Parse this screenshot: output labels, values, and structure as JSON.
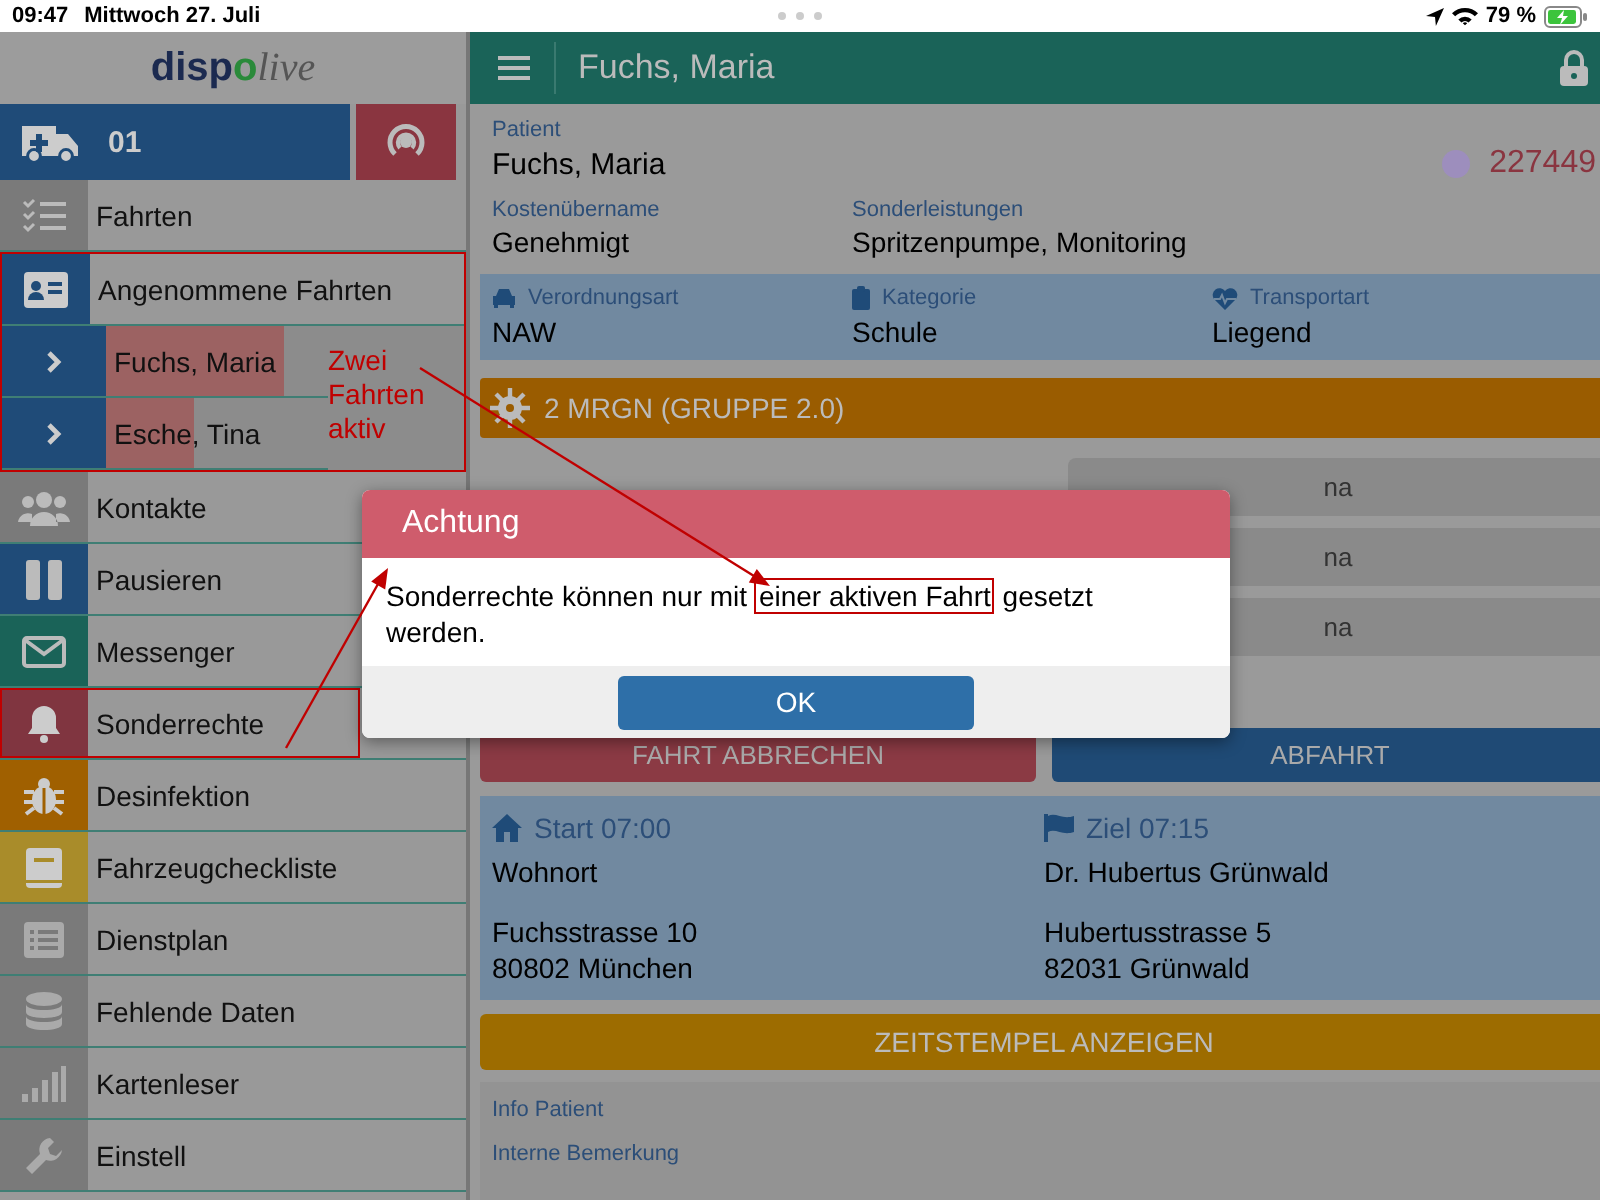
{
  "status_bar": {
    "time": "09:47",
    "date": "Mittwoch 27. Juli",
    "battery": "79 %"
  },
  "sidebar": {
    "logo": {
      "first": "disp",
      "mark": "o",
      "last": "live"
    },
    "unit": {
      "label": "01"
    },
    "items": [
      {
        "label": "Fahrten",
        "color": "#7a7a7a"
      },
      {
        "label": "Angenommene Fahrten",
        "color": "#1f4b78",
        "children": [
          {
            "label": "Fuchs, Maria",
            "level": 0.8
          },
          {
            "label": "Esche, Tina",
            "level": 0.4
          }
        ]
      },
      {
        "label": "Kontakte",
        "color": "#7a7a7a"
      },
      {
        "label": "Pausieren",
        "color": "#1f4b78"
      },
      {
        "label": "Messenger",
        "color": "#1a6358"
      },
      {
        "label": "Sonderrechte",
        "color": "#803540"
      },
      {
        "label": "Desinfektion",
        "color": "#a06000"
      },
      {
        "label": "Fahrzeugcheckliste",
        "color": "#a98c2a"
      },
      {
        "label": "Dienstplan",
        "color": "#7a7a7a"
      },
      {
        "label": "Fehlende Daten",
        "color": "#7a7a7a"
      },
      {
        "label": "Kartenleser",
        "color": "#7a7a7a"
      },
      {
        "label": "Einstell",
        "color": "#7a7a7a"
      }
    ]
  },
  "header": {
    "title": "Fuchs, Maria"
  },
  "patient": {
    "label": "Patient",
    "name": "Fuchs, Maria",
    "number": "227449"
  },
  "fields": [
    {
      "label": "Kostenübername",
      "value": "Genehmigt"
    },
    {
      "label": "Sonderleistungen",
      "value": "Spritzenpumpe, Monitoring"
    }
  ],
  "transport": [
    {
      "label": "Verordnungsart",
      "value": "NAW"
    },
    {
      "label": "Kategorie",
      "value": "Schule"
    },
    {
      "label": "Transportart",
      "value": "Liegend"
    }
  ],
  "infection": "2 MRGN (GRUPPE 2.0)",
  "status_buttons": [
    "na",
    "na",
    "na"
  ],
  "actions": [
    {
      "label": "FAHRT ABBRECHEN",
      "kind": "cancel"
    },
    {
      "label": "ABFAHRT",
      "kind": "go"
    }
  ],
  "route": [
    {
      "heading": "Start 07:00",
      "place": "Wohnort",
      "street": "Fuchsstrasse 10",
      "city": "80802 München"
    },
    {
      "heading": "Ziel 07:15",
      "place": "Dr. Hubertus Grünwald",
      "street": "Hubertusstrasse 5",
      "city": "82031 Grünwald"
    }
  ],
  "timestamps_button": "ZEITSTEMPEL ANZEIGEN",
  "info": [
    "Info Patient",
    "Interne Bemerkung"
  ],
  "dialog": {
    "title": "Achtung",
    "message": {
      "before": "Sonderrechte können nur mit ",
      "highlight": "einer aktiven Fahrt",
      "after": " gesetzt werden."
    },
    "ok": "OK"
  },
  "annotation": {
    "note": "Zwei Fahrten aktiv"
  }
}
